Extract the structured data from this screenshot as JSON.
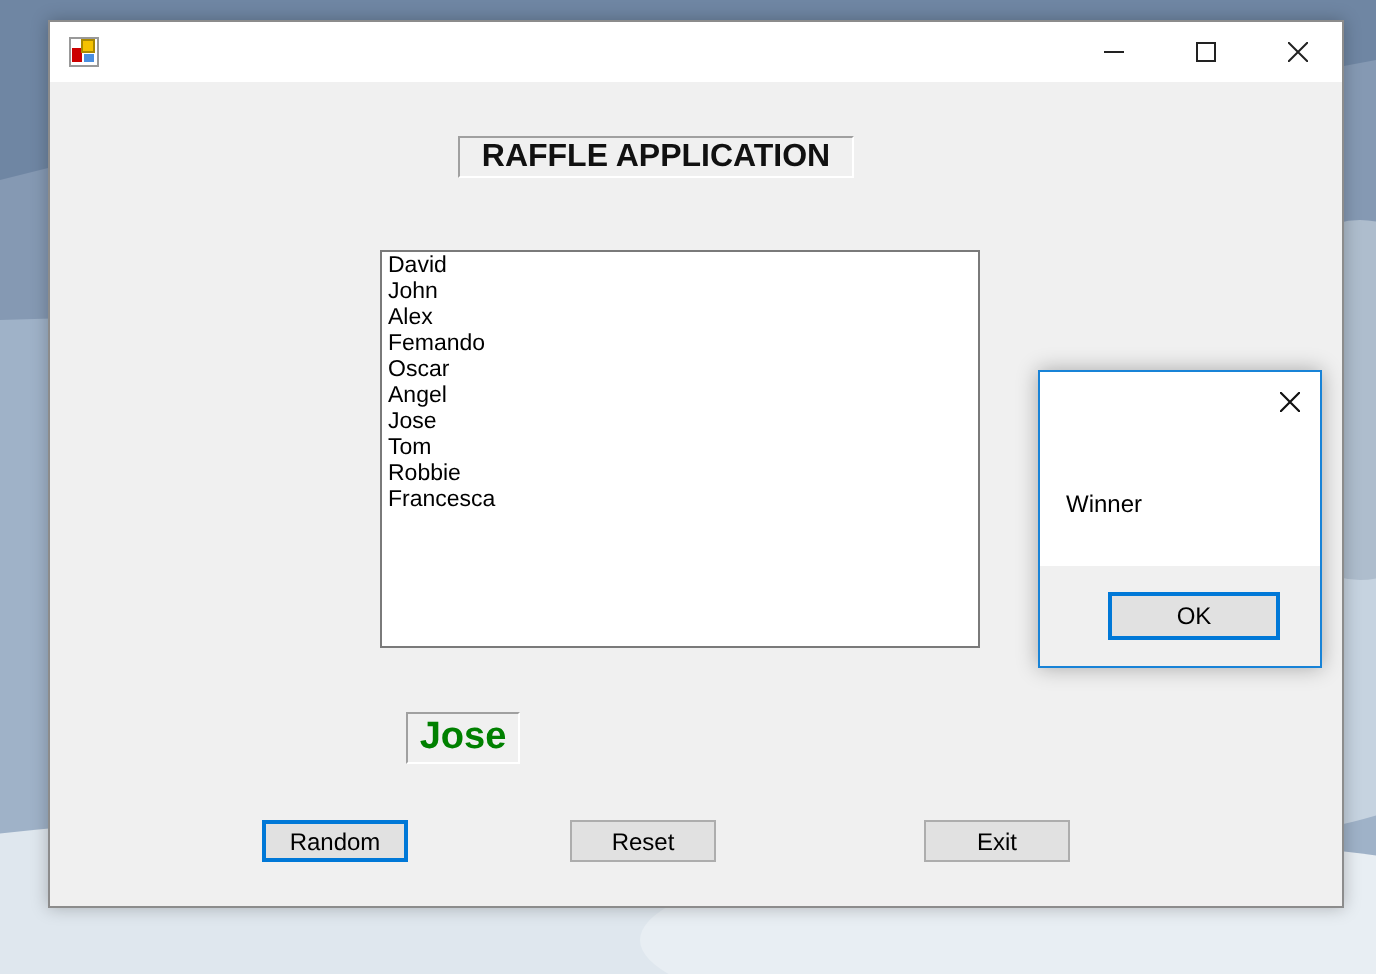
{
  "form": {
    "heading": "RAFFLE APPLICATION",
    "entries": [
      "David",
      "John",
      "Alex",
      "Femando",
      "Oscar",
      "Angel",
      "Jose",
      "Tom",
      "Robbie",
      "Francesca"
    ],
    "result": "Jose",
    "buttons": [
      {
        "label": "Random",
        "focused": true
      },
      {
        "label": "Reset",
        "focused": false
      },
      {
        "label": "Exit",
        "focused": false
      }
    ]
  },
  "dialog": {
    "message": "Winner",
    "button": {
      "label": "OK",
      "focused": true
    }
  }
}
